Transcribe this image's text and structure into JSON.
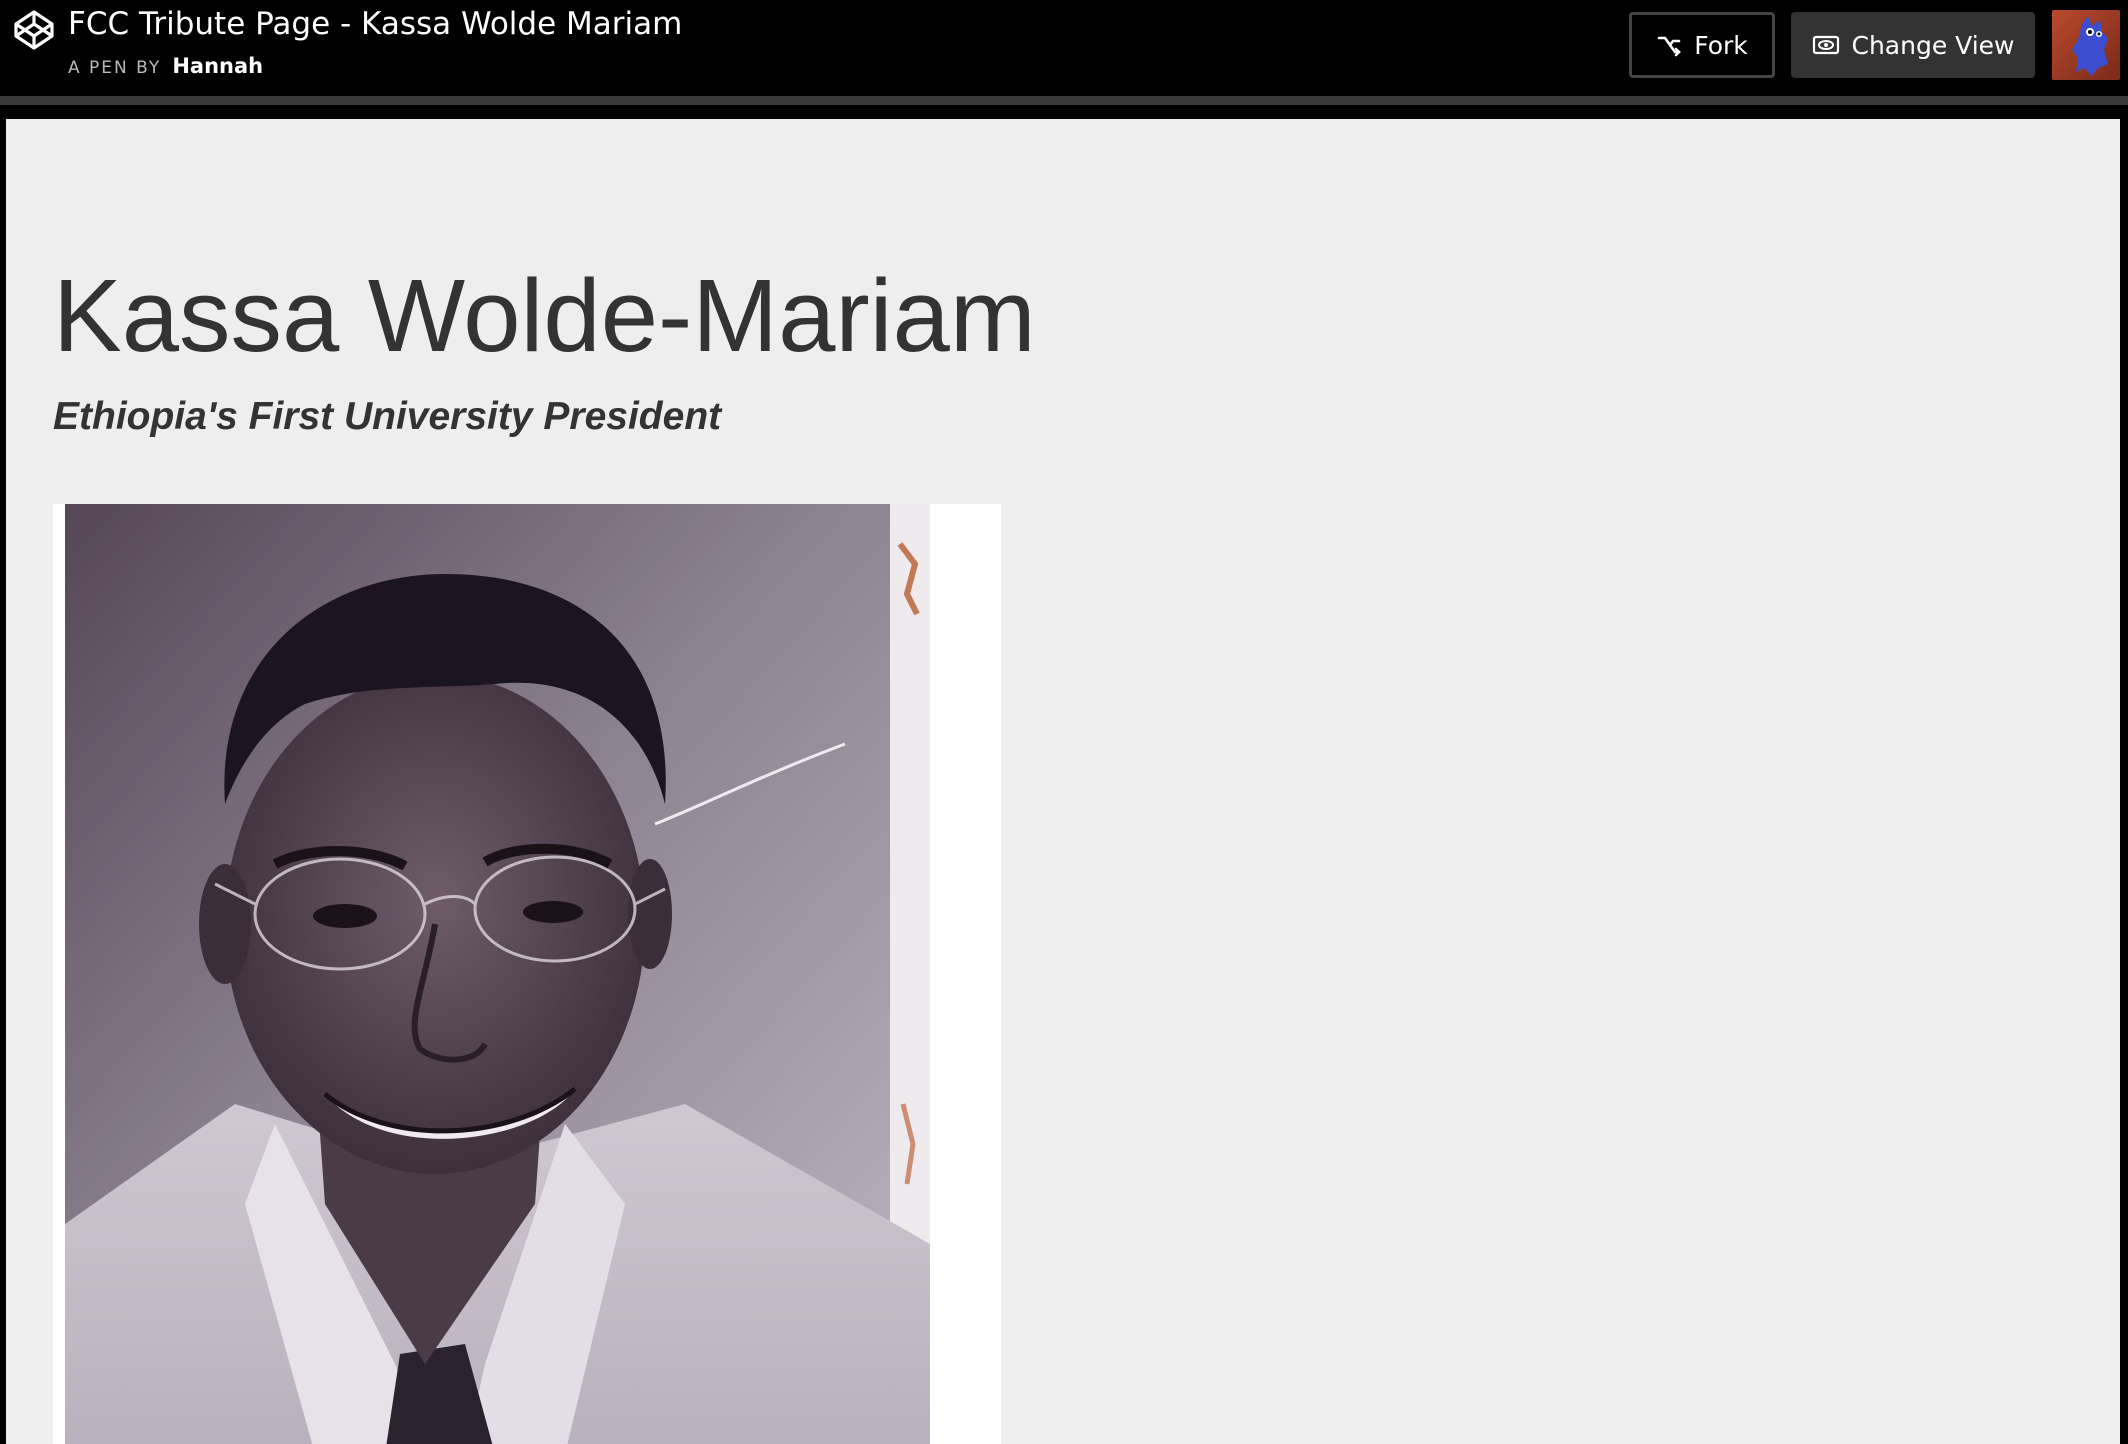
{
  "header": {
    "title": "FCC Tribute Page - Kassa Wolde Mariam",
    "byline_prefix": "A PEN BY",
    "author": "Hannah",
    "fork_label": "Fork",
    "change_view_label": "Change View"
  },
  "icons": {
    "logo": "codepen-logo-icon",
    "fork": "fork-icon",
    "change_view": "eye-icon",
    "avatar": "user-avatar"
  },
  "page": {
    "title": "Kassa Wolde-Mariam",
    "subtitle": "Ethiopia's First University President"
  },
  "colors": {
    "topbar_bg": "#000000",
    "page_bg": "#eeeeee",
    "text": "#333333",
    "button_bg": "#333333"
  }
}
